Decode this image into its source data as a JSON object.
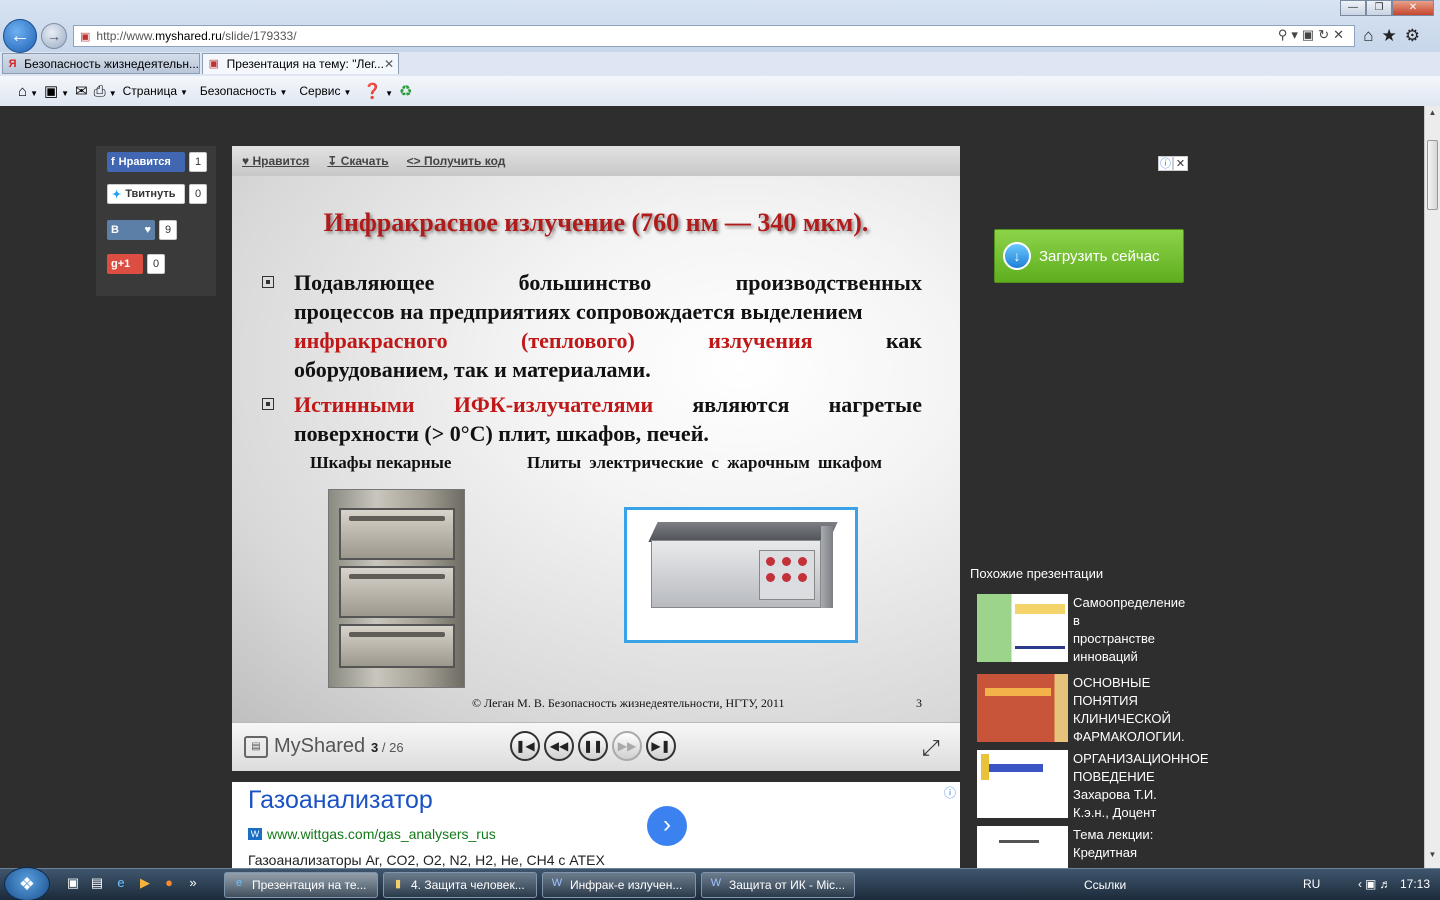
{
  "browser": {
    "url_prefix": "http://www.",
    "url_domain": "myshared.ru",
    "url_path": "/slide/179333/",
    "tabs": [
      {
        "label": "Безопасность жизнедеятельн...",
        "active": false
      },
      {
        "label": "Презентация на тему: \"Лег...",
        "active": true
      }
    ],
    "commands": {
      "page": "Страница",
      "safety": "Безопасность",
      "service": "Сервис"
    }
  },
  "social": {
    "fb_label": "Нравится",
    "fb_count": "1",
    "tw_label": "Твитнуть",
    "tw_count": "0",
    "vk_label": "В",
    "vk_count": "9",
    "gp_label": "g+1",
    "gp_count": "0"
  },
  "viewer": {
    "toolbar": {
      "like": "Нравится",
      "download": "Скачать",
      "embed": "Получить код"
    },
    "brand": "MyShared",
    "current_slide": "3",
    "total_slides": "/ 26"
  },
  "slide": {
    "title": "Инфракрасное излучение (760 нм — 340 мкм).",
    "b1_l1": [
      "Подавляющее",
      "большинство",
      "производственных"
    ],
    "b1_l2": "процессов на предприятиях сопровождается выделением",
    "b1_l3": [
      "инфракрасного",
      "(теплового)",
      "излучения",
      "как"
    ],
    "b1_l4": "оборудованием, так и материалами.",
    "b2_l1": [
      "Истинными",
      "ИФК-излучателями",
      "являются",
      "нагретые"
    ],
    "b2_l2": "поверхности (> 0°С) плит, шкафов, печей.",
    "caption_left": "Шкафы пекарные",
    "caption_right": "Плиты электрические с жарочным шкафом",
    "footer": "© Леган М. В. Безопасность жизнедеятельности, НГТУ, 2011",
    "number": "3"
  },
  "ad_bottom": {
    "title": "Газоанализатор",
    "url": "www.wittgas.com/gas_analysers_rus",
    "desc": "Газоанализаторы Ar, CO2, O2, N2, H2, He, CH4 с ATEX"
  },
  "ad_right": {
    "button": "Загрузить сейчас"
  },
  "similar": {
    "title": "Похожие презентации",
    "items": [
      {
        "label": "Самоопределение\nв\nпространстве\nинноваций"
      },
      {
        "label": "ОСНОВНЫЕ\nПОНЯТИЯ\nКЛИНИЧЕСКОЙ\nФАРМАКОЛОГИИ."
      },
      {
        "label": "ОРГАНИЗАЦИОННОЕ\nПОВЕДЕНИЕ\nЗахарова Т.И.\nК.э.н., Доцент"
      },
      {
        "label": "Тема лекции:\nКредитная"
      }
    ]
  },
  "taskbar": {
    "tasks": [
      "Презентация на те...",
      "4. Защита человек...",
      "Инфрак-е излучен...",
      "Защита от ИК - Mic..."
    ],
    "links": "Ссылки",
    "lang": "RU",
    "time": "17:13"
  }
}
